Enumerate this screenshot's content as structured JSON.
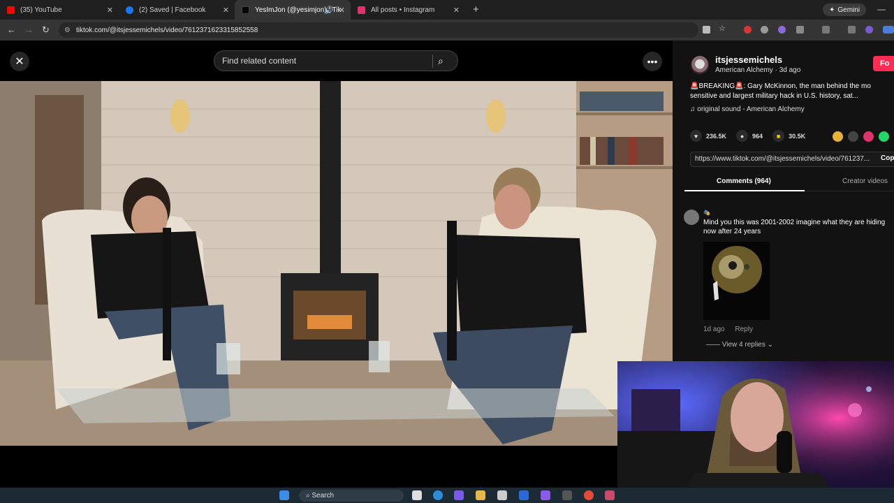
{
  "browser": {
    "tabs": [
      {
        "title": "(35) YouTube",
        "favicon_color": "#ff0000",
        "active": false
      },
      {
        "title": "(2) Saved | Facebook",
        "favicon_color": "#1877f2",
        "active": false
      },
      {
        "title": "YesImJon (@yesimjon) | Tik",
        "favicon_color": "#000000",
        "active": true
      },
      {
        "title": "All posts • Instagram",
        "favicon_color": "#e1306c",
        "active": false
      }
    ],
    "new_tab": "+",
    "gemini_label": "Gemini",
    "url": "tiktok.com/@itsjessemichels/video/7612371623315852558"
  },
  "player": {
    "close": "✕",
    "search_placeholder": "Find related content",
    "more": "•••",
    "down": "⌄"
  },
  "post": {
    "username": "itsjessemichels",
    "subline": "American Alchemy · 3d ago",
    "follow": "Fo",
    "description_line1": "🚨BREAKING🚨: Gary McKinnon, the man behind the mo",
    "description_line2": "sensitive and largest military hack in U.S. history, sat...",
    "sound": "original sound - American Alchemy",
    "likes": "236.5K",
    "comments": "964",
    "saves": "30.5K",
    "link": "https://www.tiktok.com/@itsjessemichels/video/761237...",
    "copy": "Cop",
    "tab_comments": "Comments (964)",
    "tab_creator": "Creator videos",
    "accent": "#fe2c55"
  },
  "comment": {
    "user": "🎭",
    "text": "Mind you this was 2001-2002 imagine what they are hiding now after 24 years",
    "age": "1d ago",
    "reply": "Reply",
    "view_replies": "View 4 replies"
  },
  "taskbar": {
    "search": "Search"
  }
}
